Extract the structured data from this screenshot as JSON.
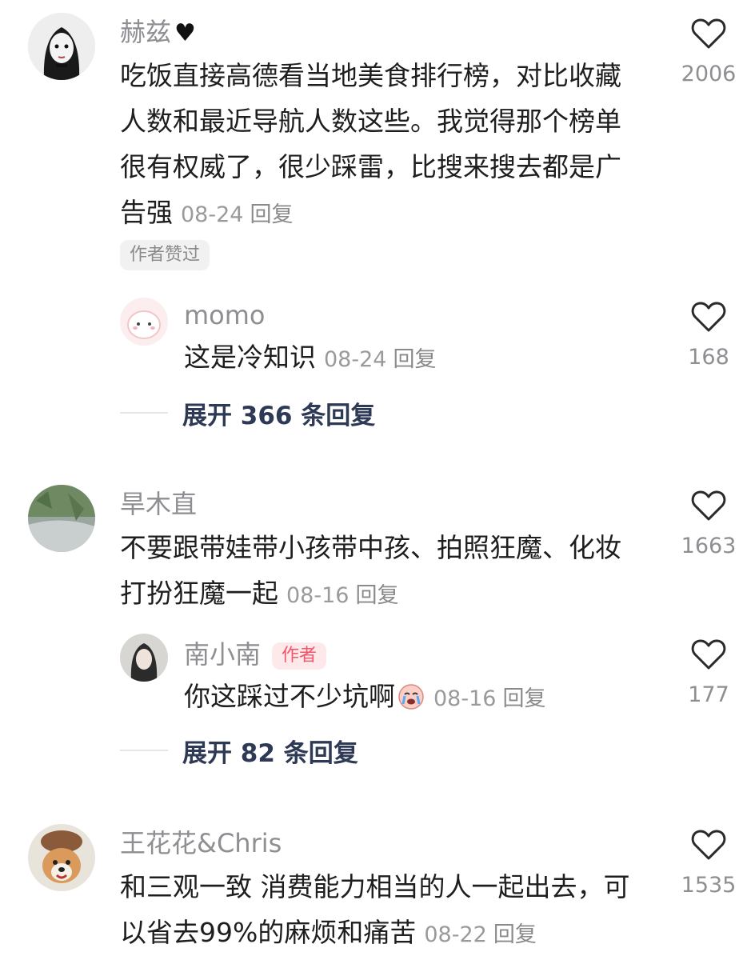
{
  "comments": [
    {
      "user": "赫兹",
      "lines": [
        "吃饭直接高德看当地美食排行榜，对比收藏",
        "人数和最近导航人数这些。我觉得那个榜单",
        "很有权威了，很少踩雷，比搜来搜去都是广",
        "告强"
      ],
      "date": "08-24",
      "reply": "回复",
      "likes": "2006",
      "liked_badge": "作者赞过",
      "sub_reply": {
        "user": "momo",
        "text": "这是冷知识",
        "date": "08-24",
        "reply": "回复",
        "likes": "168"
      },
      "expand_label": "展开 366 条回复"
    },
    {
      "user": "旱木直",
      "lines": [
        "不要跟带娃带小孩带中孩、拍照狂魔、化妆",
        "打扮狂魔一起"
      ],
      "date": "08-16",
      "reply": "回复",
      "likes": "1663",
      "sub_reply": {
        "user": "南小南",
        "author_tag": "作者",
        "text": "你这踩过不少坑啊",
        "date": "08-16",
        "reply": "回复",
        "likes": "177"
      },
      "expand_label": "展开 82 条回复"
    },
    {
      "user": "王花花&Chris",
      "lines": [
        "和三观一致 消费能力相当的人一起出去，可",
        "以省去99%的麻烦和痛苦"
      ],
      "date": "08-22",
      "reply": "回复",
      "likes": "1535"
    }
  ],
  "icons": {
    "like": "heart-outline-icon",
    "user_emoji": "black-heart-icon",
    "reply_emoji": "crying-face-icon"
  },
  "colors": {
    "author_tag_bg": "#fde9ea",
    "author_tag_text": "#f0556b",
    "expand_text": "#2e3a55"
  }
}
